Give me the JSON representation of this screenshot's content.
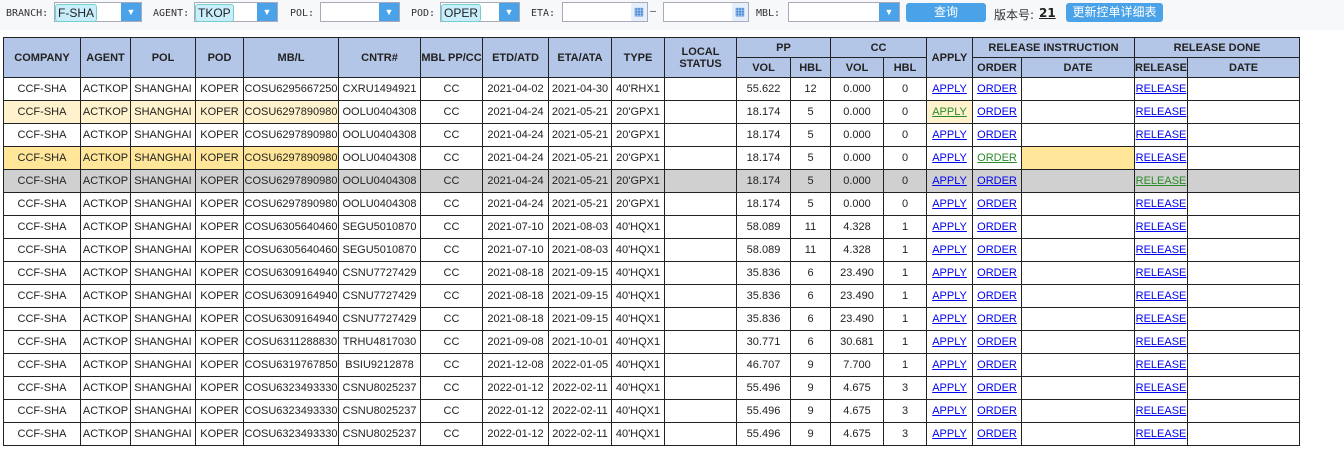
{
  "filters": {
    "branch_label": "BRANCH:",
    "branch_value": "F-SHA",
    "agent_label": "AGENT:",
    "agent_value": "TKOP",
    "pol_label": "POL:",
    "pol_value": "",
    "pod_label": "POD:",
    "pod_value": "OPER",
    "eta_label": "ETA:",
    "eta_sep": "—",
    "mbl_label": "MBL:",
    "query_button": "查询",
    "version_label": "版本号:",
    "version_value": "21",
    "update_button": "更新控单详细表"
  },
  "headers": {
    "company": "COMPANY",
    "agent": "AGENT",
    "pol": "POL",
    "pod": "POD",
    "mbl": "MB/L",
    "cntr": "CNTR#",
    "mbl_ppcc": "MBL PP/CC",
    "etd": "ETD/ATD",
    "eta": "ETA/ATA",
    "type": "TYPE",
    "local_status": "LOCAL STATUS",
    "pp": "PP",
    "cc": "CC",
    "apply": "APPLY",
    "release_instruction": "RELEASE INSTRUCTION",
    "release_done": "RELEASE DONE",
    "vol": "VOL",
    "hbl": "HBL",
    "order": "ORDER",
    "date": "DATE",
    "release": "RELEASE"
  },
  "link_labels": {
    "apply": "APPLY",
    "order": "ORDER",
    "release": "RELEASE"
  },
  "rows": [
    [
      "CCF-SHA",
      "ACTKOP",
      "SHANGHAI",
      "KOPER",
      "COSU6295667250",
      "CXRU1494921",
      "CC",
      "2021-04-02",
      "2021-04-30",
      "40'RHX1",
      "",
      "55.622",
      "12",
      "0.000",
      "0"
    ],
    [
      "CCF-SHA",
      "ACTKOP",
      "SHANGHAI",
      "KOPER",
      "COSU6297890980",
      "OOLU0404308",
      "CC",
      "2021-04-24",
      "2021-05-21",
      "20'GPX1",
      "",
      "18.174",
      "5",
      "0.000",
      "0"
    ],
    [
      "CCF-SHA",
      "ACTKOP",
      "SHANGHAI",
      "KOPER",
      "COSU6297890980",
      "OOLU0404308",
      "CC",
      "2021-04-24",
      "2021-05-21",
      "20'GPX1",
      "",
      "18.174",
      "5",
      "0.000",
      "0"
    ],
    [
      "CCF-SHA",
      "ACTKOP",
      "SHANGHAI",
      "KOPER",
      "COSU6297890980",
      "OOLU0404308",
      "CC",
      "2021-04-24",
      "2021-05-21",
      "20'GPX1",
      "",
      "18.174",
      "5",
      "0.000",
      "0"
    ],
    [
      "CCF-SHA",
      "ACTKOP",
      "SHANGHAI",
      "KOPER",
      "COSU6297890980",
      "OOLU0404308",
      "CC",
      "2021-04-24",
      "2021-05-21",
      "20'GPX1",
      "",
      "18.174",
      "5",
      "0.000",
      "0"
    ],
    [
      "CCF-SHA",
      "ACTKOP",
      "SHANGHAI",
      "KOPER",
      "COSU6297890980",
      "OOLU0404308",
      "CC",
      "2021-04-24",
      "2021-05-21",
      "20'GPX1",
      "",
      "18.174",
      "5",
      "0.000",
      "0"
    ],
    [
      "CCF-SHA",
      "ACTKOP",
      "SHANGHAI",
      "KOPER",
      "COSU6305640460",
      "SEGU5010870",
      "CC",
      "2021-07-10",
      "2021-08-03",
      "40'HQX1",
      "",
      "58.089",
      "11",
      "4.328",
      "1"
    ],
    [
      "CCF-SHA",
      "ACTKOP",
      "SHANGHAI",
      "KOPER",
      "COSU6305640460",
      "SEGU5010870",
      "CC",
      "2021-07-10",
      "2021-08-03",
      "40'HQX1",
      "",
      "58.089",
      "11",
      "4.328",
      "1"
    ],
    [
      "CCF-SHA",
      "ACTKOP",
      "SHANGHAI",
      "KOPER",
      "COSU6309164940",
      "CSNU7727429",
      "CC",
      "2021-08-18",
      "2021-09-15",
      "40'HQX1",
      "",
      "35.836",
      "6",
      "23.490",
      "1"
    ],
    [
      "CCF-SHA",
      "ACTKOP",
      "SHANGHAI",
      "KOPER",
      "COSU6309164940",
      "CSNU7727429",
      "CC",
      "2021-08-18",
      "2021-09-15",
      "40'HQX1",
      "",
      "35.836",
      "6",
      "23.490",
      "1"
    ],
    [
      "CCF-SHA",
      "ACTKOP",
      "SHANGHAI",
      "KOPER",
      "COSU6309164940",
      "CSNU7727429",
      "CC",
      "2021-08-18",
      "2021-09-15",
      "40'HQX1",
      "",
      "35.836",
      "6",
      "23.490",
      "1"
    ],
    [
      "CCF-SHA",
      "ACTKOP",
      "SHANGHAI",
      "KOPER",
      "COSU6311288830",
      "TRHU4817030",
      "CC",
      "2021-09-08",
      "2021-10-01",
      "40'HQX1",
      "",
      "30.771",
      "6",
      "30.681",
      "1"
    ],
    [
      "CCF-SHA",
      "ACTKOP",
      "SHANGHAI",
      "KOPER",
      "COSU6319767850",
      "BSIU9212878",
      "CC",
      "2021-12-08",
      "2022-01-05",
      "40'HQX1",
      "",
      "46.707",
      "9",
      "7.700",
      "1"
    ],
    [
      "CCF-SHA",
      "ACTKOP",
      "SHANGHAI",
      "KOPER",
      "COSU6323493330",
      "CSNU8025237",
      "CC",
      "2022-01-12",
      "2022-02-11",
      "40'HQX1",
      "",
      "55.496",
      "9",
      "4.675",
      "3"
    ],
    [
      "CCF-SHA",
      "ACTKOP",
      "SHANGHAI",
      "KOPER",
      "COSU6323493330",
      "CSNU8025237",
      "CC",
      "2022-01-12",
      "2022-02-11",
      "40'HQX1",
      "",
      "55.496",
      "9",
      "4.675",
      "3"
    ],
    [
      "CCF-SHA",
      "ACTKOP",
      "SHANGHAI",
      "KOPER",
      "COSU6323493330",
      "CSNU8025237",
      "CC",
      "2022-01-12",
      "2022-02-11",
      "40'HQX1",
      "",
      "55.496",
      "9",
      "4.675",
      "3"
    ]
  ],
  "colors": {
    "header_bg": "#b4c6e7",
    "accent": "#4aa3e8",
    "highlight_light": "#fff2cc",
    "highlight": "#ffe699",
    "selected_row": "#d0d0d0"
  }
}
